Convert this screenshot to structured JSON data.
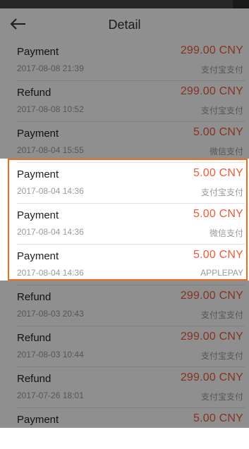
{
  "header": {
    "title": "Detail",
    "back_icon": "back-arrow-icon"
  },
  "transactions": [
    {
      "type": "Payment",
      "time": "2017-08-08 21:39",
      "amount": "299.00 CNY",
      "method": "支付宝支付"
    },
    {
      "type": "Refund",
      "time": "2017-08-08 10:52",
      "amount": "299.00 CNY",
      "method": "支付宝支付"
    },
    {
      "type": "Payment",
      "time": "2017-08-04 15:55",
      "amount": "5.00 CNY",
      "method": "微信支付"
    },
    {
      "type": "Payment",
      "time": "2017-08-04 14:36",
      "amount": "5.00 CNY",
      "method": "支付宝支付"
    },
    {
      "type": "Payment",
      "time": "2017-08-04 14:36",
      "amount": "5.00 CNY",
      "method": "微信支付"
    },
    {
      "type": "Payment",
      "time": "2017-08-04 14:36",
      "amount": "5.00 CNY",
      "method": "APPLEPAY"
    },
    {
      "type": "Refund",
      "time": "2017-08-03 20:43",
      "amount": "299.00 CNY",
      "method": "支付宝支付"
    },
    {
      "type": "Refund",
      "time": "2017-08-03 10:44",
      "amount": "299.00 CNY",
      "method": "支付宝支付"
    },
    {
      "type": "Refund",
      "time": "2017-07-26 18:01",
      "amount": "299.00 CNY",
      "method": "支付宝支付"
    },
    {
      "type": "Payment",
      "time": "",
      "amount": "5.00 CNY",
      "method": ""
    }
  ],
  "colors": {
    "amount": "#f05a3a",
    "highlight_border": "#f26a1b",
    "dim_overlay": "rgba(0,0,0,0.44)"
  }
}
